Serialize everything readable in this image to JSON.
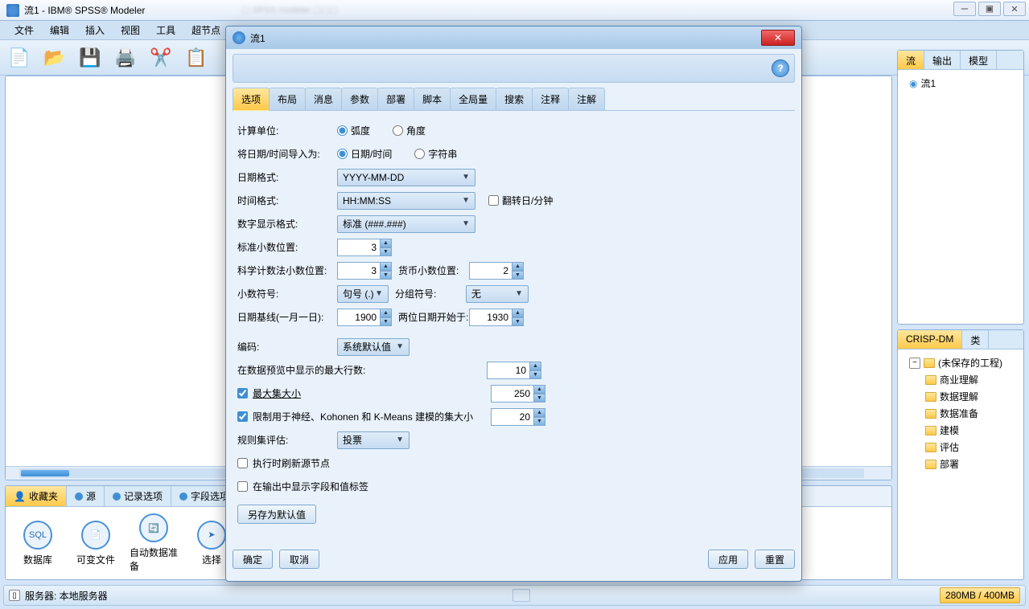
{
  "window": {
    "title": "流1 - IBM® SPSS® Modeler"
  },
  "menus": {
    "file": "文件",
    "edit": "编辑",
    "insert": "插入",
    "view": "视图",
    "tools": "工具",
    "super": "超节点"
  },
  "right": {
    "tabs": {
      "streams": "流",
      "output": "输出",
      "models": "模型",
      "stream1": "流1"
    },
    "tabs2": {
      "crisp": "CRISP-DM",
      "class": "类"
    },
    "project": "(未保存的工程)",
    "crisp": {
      "a": "商业理解",
      "b": "数据理解",
      "c": "数据准备",
      "d": "建模",
      "e": "评估",
      "f": "部署"
    }
  },
  "palette": {
    "tabs": {
      "fav": "收藏夹",
      "source": "源",
      "record": "记录选项",
      "field": "字段选项"
    },
    "nodes": {
      "db": "数据库",
      "var": "可变文件",
      "auto": "自动数据准备",
      "sel": "选择",
      "sql": "SQL"
    }
  },
  "dialog": {
    "title": "流1",
    "tabs": {
      "options": "选项",
      "layout": "布局",
      "messages": "消息",
      "params": "参数",
      "deploy": "部署",
      "script": "脚本",
      "globals": "全局量",
      "search": "搜索",
      "comments": "注释",
      "annot": "注解"
    },
    "labels": {
      "calcunit": "计算单位:",
      "radians": "弧度",
      "degrees": "角度",
      "importdt": "将日期/时间导入为:",
      "datetime": "日期/时间",
      "string": "字符串",
      "datefmt": "日期格式:",
      "datefmt_v": "YYYY-MM-DD",
      "timefmt": "时间格式:",
      "timefmt_v": "HH:MM:SS",
      "rollover": "翻转日/分钟",
      "numfmt": "数字显示格式:",
      "numfmt_v": "标准 (###.###)",
      "stddec": "标准小数位置:",
      "stddec_v": "3",
      "scidec": "科学计数法小数位置:",
      "scidec_v": "3",
      "curdec": "货币小数位置:",
      "curdec_v": "2",
      "decsym": "小数符号:",
      "decsym_v": "句号 (.)",
      "grpsym": "分组符号:",
      "grpsym_v": "无",
      "baseline": "日期基线(一月一日):",
      "baseline_v": "1900",
      "twodigit": "两位日期开始于:",
      "twodigit_v": "1930",
      "encoding": "编码:",
      "encoding_v": "系统默认值",
      "maxrows": "在数据预览中显示的最大行数:",
      "maxrows_v": "10",
      "maxset": "最大集大小",
      "maxset_v": "250",
      "kmeans": "限制用于神经、Kohonen 和 K-Means 建模的集大小",
      "kmeans_v": "20",
      "rules": "规则集评估:",
      "rules_v": "投票",
      "refresh": "执行时刷新源节点",
      "labelsout": "在输出中显示字段和值标签",
      "savedef": "另存为默认值"
    },
    "buttons": {
      "ok": "确定",
      "cancel": "取消",
      "apply": "应用",
      "reset": "重置"
    }
  },
  "status": {
    "server": "服务器: 本地服务器",
    "mem": "280MB / 400MB"
  }
}
